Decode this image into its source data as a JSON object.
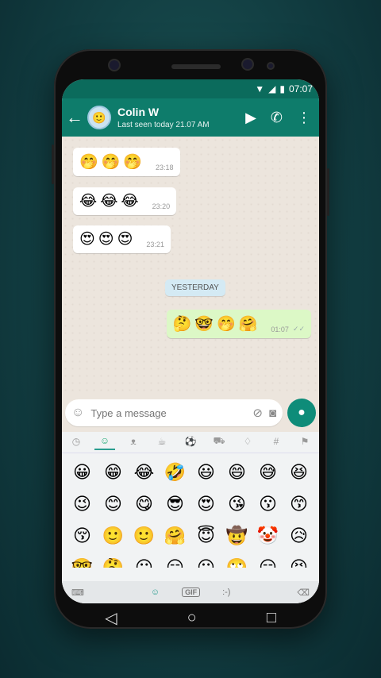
{
  "status": {
    "time": "07:07",
    "wifi_icon": "wifi-icon",
    "signal_icon": "signal-icon",
    "battery_icon": "battery-icon"
  },
  "header": {
    "contact_name": "Colin W",
    "last_seen": "Last seen today 21.07 AM",
    "icons": [
      "back-arrow-icon",
      "video-call-icon",
      "phone-call-icon",
      "more-vert-icon"
    ],
    "color": "#0e7c6b"
  },
  "messages": [
    {
      "direction": "in",
      "emoji": "🤭🤭🤭",
      "time": "23:18"
    },
    {
      "direction": "in",
      "emoji": "😂😂😂",
      "time": "23:20"
    },
    {
      "direction": "in",
      "emoji": "😍😍😍",
      "time": "23:21"
    },
    {
      "direction": "out",
      "emoji": "🤔🤓🤭🤗",
      "time": "01:07"
    }
  ],
  "day_label": "YESTERDAY",
  "composer": {
    "placeholder": "Type a message"
  },
  "keyboard": {
    "categories": [
      "recent",
      "smileys",
      "animals",
      "food",
      "sports",
      "travel",
      "objects",
      "symbols",
      "flags"
    ],
    "emojis": [
      "😀",
      "😁",
      "😂",
      "🤣",
      "😃",
      "😄",
      "😅",
      "😆",
      "😉",
      "😊",
      "😋",
      "😎",
      "😍",
      "😘",
      "😗",
      "😙",
      "😚",
      "🙂",
      "🙂",
      "🤗",
      "😇",
      "🤠",
      "🤡",
      "😥",
      "🤓",
      "🤔",
      "😐",
      "😑",
      "😶",
      "🙄",
      "😏",
      "😣"
    ],
    "bottom_labels": {
      "gif": "GIF",
      "emoticon": ":-)"
    }
  },
  "accent": "#0e8c79"
}
